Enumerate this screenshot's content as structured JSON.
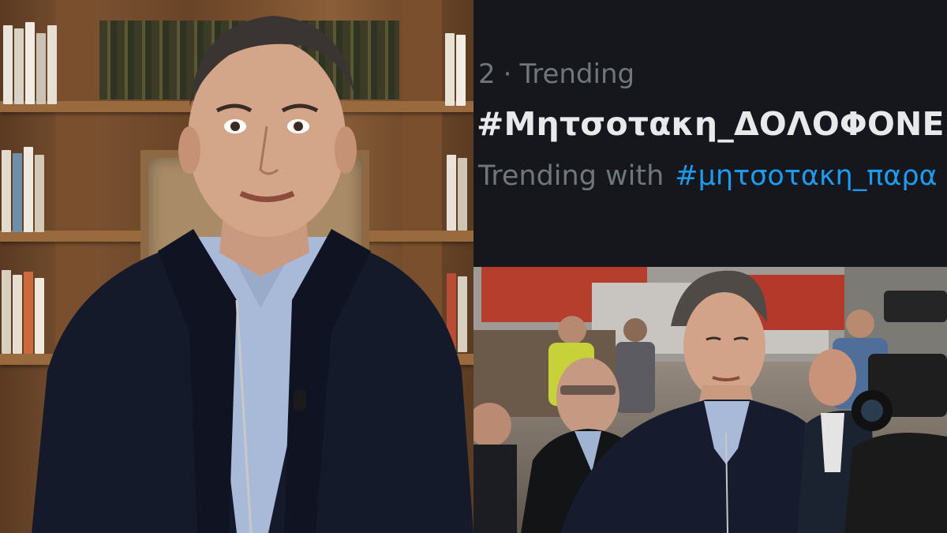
{
  "trending": {
    "rank": "2",
    "separator": "·",
    "category": "Trending",
    "hashtag": "#Μητσοτακη_ΔΟΛΟΦΟΝΕ",
    "with_label": "Trending with",
    "related_tag": "#μητσοτακη_παρα"
  },
  "colors": {
    "trend_bg": "#15171c",
    "trend_text": "#e7e9ea",
    "trend_muted": "#71767b",
    "link_blue": "#1d9bf0"
  }
}
